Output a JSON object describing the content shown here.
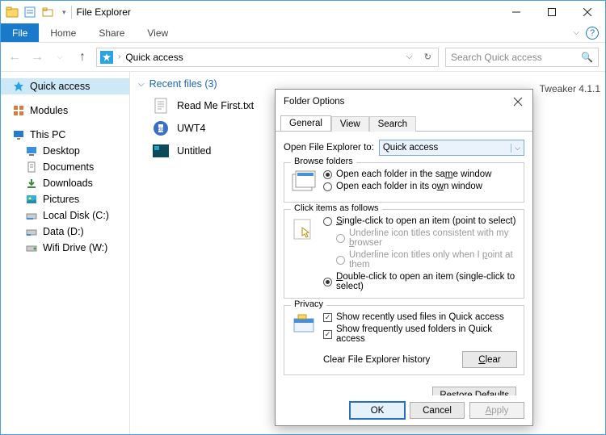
{
  "window": {
    "title": "File Explorer"
  },
  "ribbon": {
    "file": "File",
    "home": "Home",
    "share": "Share",
    "view": "View"
  },
  "address": {
    "location": "Quick access"
  },
  "search": {
    "placeholder": "Search Quick access"
  },
  "tree": {
    "quick_access": "Quick access",
    "modules": "Modules",
    "this_pc": "This PC",
    "desktop": "Desktop",
    "documents": "Documents",
    "downloads": "Downloads",
    "pictures": "Pictures",
    "local_c": "Local Disk (C:)",
    "data_d": "Data (D:)",
    "wifi_w": "Wifi Drive (W:)"
  },
  "content": {
    "recent_header": "Recent files (3)",
    "files": {
      "f0": "Read Me First.txt",
      "f1": "UWT4",
      "f2": "Untitled"
    },
    "back_text": "Tweaker 4.1.1"
  },
  "dialog": {
    "title": "Folder Options",
    "tabs": {
      "general": "General",
      "view": "View",
      "search": "Search"
    },
    "open_label": "Open File Explorer to:",
    "open_value": "Quick access",
    "groups": {
      "browse": {
        "title": "Browse folders",
        "same": "Open each folder in the same window",
        "own": "Open each folder in its own window",
        "same_ul": "m",
        "own_ul": "w"
      },
      "click": {
        "title": "Click items as follows",
        "single": "Single-click to open an item (point to select)",
        "single_ul": "S",
        "u1": "Underline icon titles consistent with my browser",
        "u1_ul": "b",
        "u2": "Underline icon titles only when I point at them",
        "u2_ul": "p",
        "double": "Double-click to open an item (single-click to select)",
        "double_ul": "D"
      },
      "privacy": {
        "title": "Privacy",
        "recent": "Show recently used files in Quick access",
        "freq": "Show frequently used folders in Quick access",
        "clear_label": "Clear File Explorer history",
        "clear_btn": "Clear",
        "clear_ul": "C"
      }
    },
    "restore": "Restore Defaults",
    "restore_ul": "R",
    "buttons": {
      "ok": "OK",
      "cancel": "Cancel",
      "apply": "Apply",
      "apply_ul": "A"
    }
  }
}
